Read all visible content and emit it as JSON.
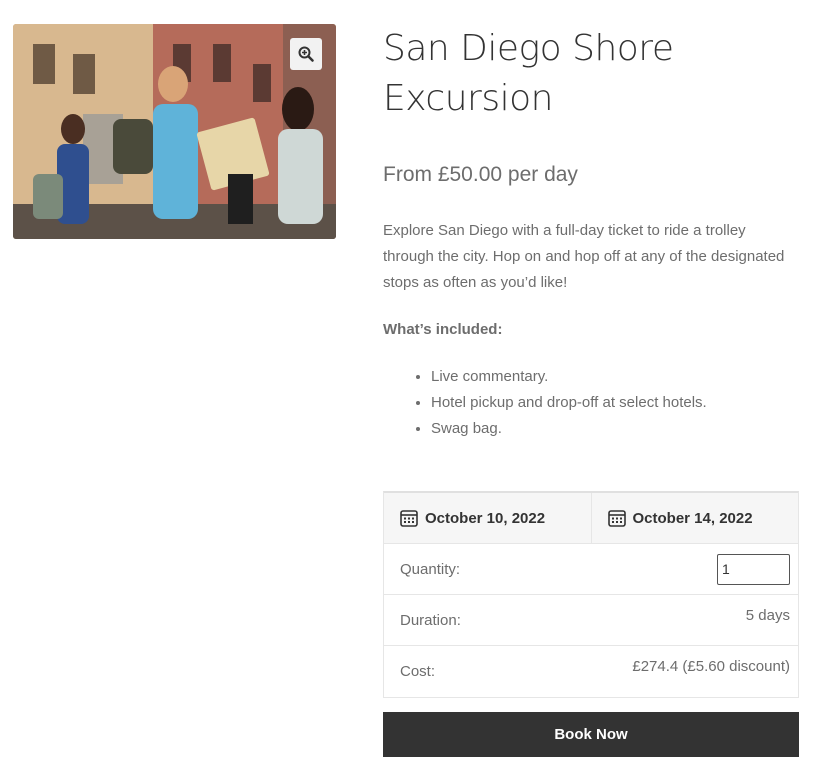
{
  "product": {
    "title": "San Diego Shore Excursion",
    "price": "From £50.00 per day",
    "description": "Explore San Diego with a full-day ticket to ride a trolley through the city. Hop on and hop off at any of the designated stops as often as you’d like!",
    "included_heading": "What’s included:",
    "included_items": [
      "Live commentary.",
      "Hotel pickup and drop-off at select hotels.",
      "Swag bag."
    ]
  },
  "gallery": {
    "image_semantic": "tourists-with-map-photo",
    "zoom_icon": "zoom-in-icon"
  },
  "booking": {
    "start_date": "October 10, 2022",
    "end_date": "October 14, 2022",
    "calendar_icon": "calendar-icon",
    "quantity_label": "Quantity:",
    "quantity_value": "1",
    "duration_label": "Duration:",
    "duration_value": "5 days",
    "cost_label": "Cost:",
    "cost_value": "£274.4 (£5.60 discount)",
    "book_button": "Book Now"
  },
  "colors": {
    "title": "#333333",
    "body_text": "#6d6d6d",
    "button_bg": "#333333",
    "button_text": "#ffffff",
    "date_row_bg": "#f6f6f6"
  }
}
